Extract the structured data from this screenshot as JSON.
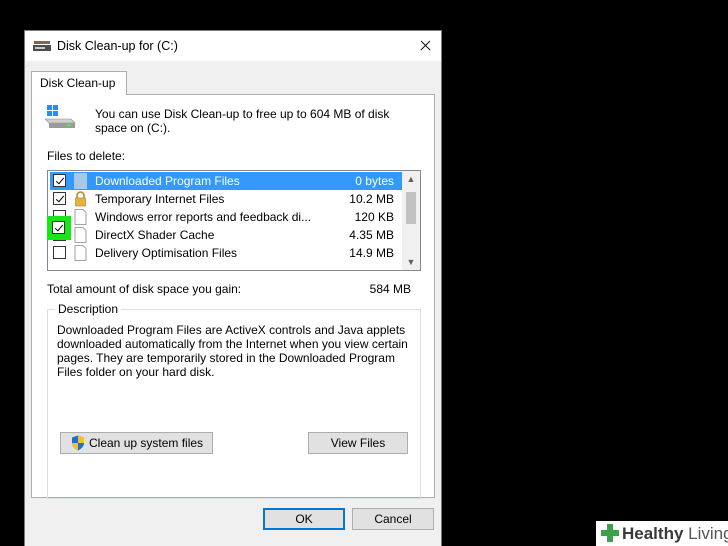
{
  "window": {
    "title": "Disk Clean-up for  (C:)"
  },
  "tab": {
    "label": "Disk Clean-up"
  },
  "intro": {
    "text": "You can use Disk Clean-up to free up to 604 MB of disk space on  (C:)."
  },
  "files": {
    "label": "Files to delete:",
    "items": [
      {
        "name": "Downloaded Program Files",
        "size": "0 bytes",
        "checked": true,
        "selected": true
      },
      {
        "name": "Temporary Internet Files",
        "size": "10.2 MB",
        "checked": true,
        "selected": false
      },
      {
        "name": "Windows error reports and feedback di...",
        "size": "120 KB",
        "checked": false,
        "selected": false
      },
      {
        "name": "DirectX Shader Cache",
        "size": "4.35 MB",
        "checked": false,
        "selected": false
      },
      {
        "name": "Delivery Optimisation Files",
        "size": "14.9 MB",
        "checked": false,
        "selected": false
      }
    ]
  },
  "total": {
    "label": "Total amount of disk space you gain:",
    "value": "584 MB"
  },
  "description": {
    "title": "Description",
    "text": "Downloaded Program Files are ActiveX controls and Java applets downloaded automatically from the Internet when you view certain pages. They are temporarily stored in the Downloaded Program Files folder on your hard disk."
  },
  "buttons": {
    "cleanup_system": "Clean up system files",
    "view_files": "View Files",
    "ok": "OK",
    "cancel": "Cancel"
  },
  "logo": {
    "word1": "Healthy",
    "word2": "Living"
  },
  "colors": {
    "selection": "#3399ff",
    "highlight": "#19e619",
    "focus_border": "#0078d7",
    "logo_green": "#3aa24a"
  }
}
